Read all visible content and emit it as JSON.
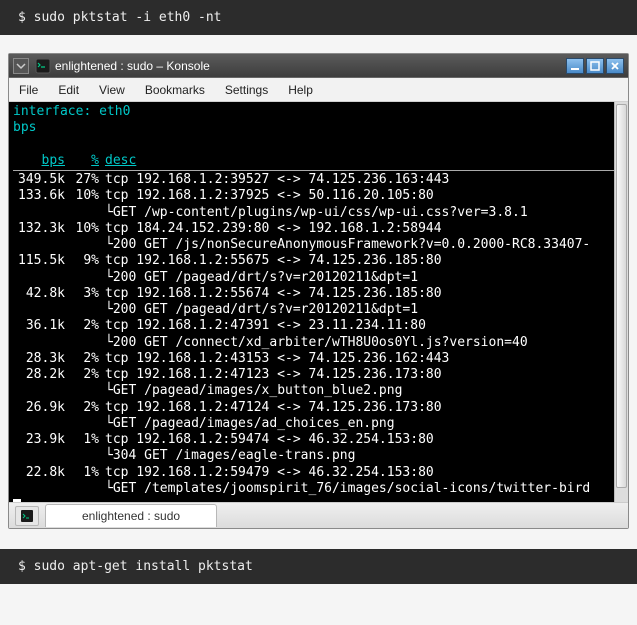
{
  "outer_prompt": "$ ",
  "cmd1": "sudo pktstat -i eth0 -nt",
  "cmd2": "sudo apt-get install pktstat",
  "window": {
    "title": "enlightened : sudo – Konsole",
    "menus": {
      "file": "File",
      "edit": "Edit",
      "view": "View",
      "bookmarks": "Bookmarks",
      "settings": "Settings",
      "help": "Help"
    },
    "tab": "enlightened : sudo"
  },
  "term": {
    "iface_label": "interface:",
    "iface": "eth0",
    "bps_line": "bps",
    "hdr_bps": "bps",
    "hdr_pct": "%",
    "hdr_desc": "desc",
    "rows": [
      {
        "bps": "349.5k",
        "pct": "27%",
        "desc": "tcp 192.168.1.2:39527 <-> 74.125.236.163:443"
      },
      {
        "bps": "133.6k",
        "pct": "10%",
        "desc": "tcp 192.168.1.2:37925 <-> 50.116.20.105:80",
        "sub": "GET /wp-content/plugins/wp-ui/css/wp-ui.css?ver=3.8.1"
      },
      {
        "bps": "132.3k",
        "pct": "10%",
        "desc": "tcp 184.24.152.239:80 <-> 192.168.1.2:58944",
        "sub": "200 GET /js/nonSecureAnonymousFramework?v=0.0.2000-RC8.33407-"
      },
      {
        "bps": "115.5k",
        "pct": "9%",
        "desc": "tcp 192.168.1.2:55675 <-> 74.125.236.185:80",
        "sub": "200 GET /pagead/drt/s?v=r20120211&dpt=1"
      },
      {
        "bps": "42.8k",
        "pct": "3%",
        "desc": "tcp 192.168.1.2:55674 <-> 74.125.236.185:80",
        "sub": "200 GET /pagead/drt/s?v=r20120211&dpt=1"
      },
      {
        "bps": "36.1k",
        "pct": "2%",
        "desc": "tcp 192.168.1.2:47391 <-> 23.11.234.11:80",
        "sub": "200 GET /connect/xd_arbiter/wTH8U0os0Yl.js?version=40"
      },
      {
        "bps": "28.3k",
        "pct": "2%",
        "desc": "tcp 192.168.1.2:43153 <-> 74.125.236.162:443"
      },
      {
        "bps": "28.2k",
        "pct": "2%",
        "desc": "tcp 192.168.1.2:47123 <-> 74.125.236.173:80",
        "sub": "GET /pagead/images/x_button_blue2.png"
      },
      {
        "bps": "26.9k",
        "pct": "2%",
        "desc": "tcp 192.168.1.2:47124 <-> 74.125.236.173:80",
        "sub": "GET /pagead/images/ad_choices_en.png"
      },
      {
        "bps": "23.9k",
        "pct": "1%",
        "desc": "tcp 192.168.1.2:59474 <-> 46.32.254.153:80",
        "sub": "304 GET /images/eagle-trans.png"
      },
      {
        "bps": "22.8k",
        "pct": "1%",
        "desc": "tcp 192.168.1.2:59479 <-> 46.32.254.153:80",
        "sub": "GET /templates/joomspirit_76/images/social-icons/twitter-bird"
      }
    ]
  }
}
